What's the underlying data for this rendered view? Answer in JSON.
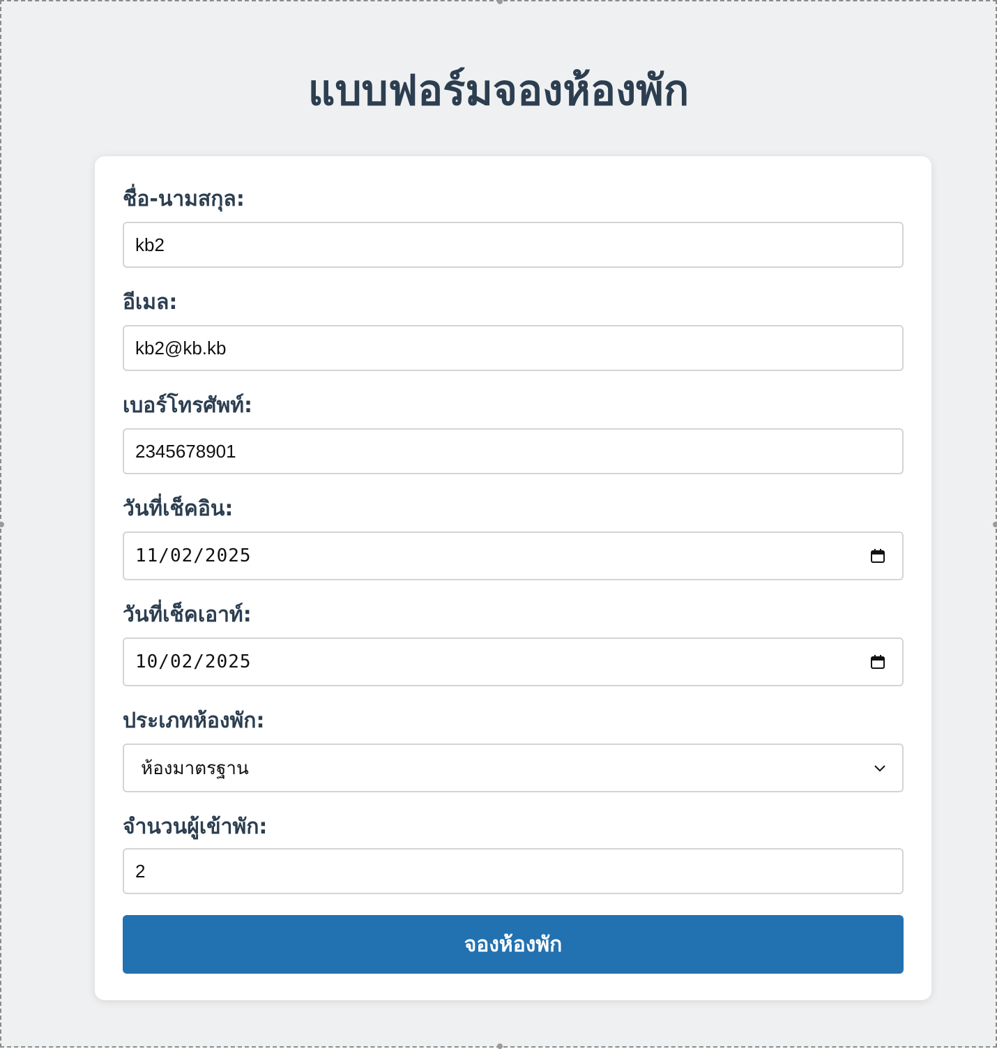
{
  "page": {
    "title": "แบบฟอร์มจองห้องพัก"
  },
  "form": {
    "name": {
      "label": "ชื่อ-นามสกุล:",
      "value": "kb2"
    },
    "email": {
      "label": "อีเมล:",
      "value": "kb2@kb.kb"
    },
    "phone": {
      "label": "เบอร์โทรศัพท์:",
      "value": "2345678901"
    },
    "checkin": {
      "label": "วันที่เช็คอิน:",
      "value": "11/02/2025",
      "icon": "calendar-icon"
    },
    "checkout": {
      "label": "วันที่เช็คเอาท์:",
      "value": "10/02/2025",
      "icon": "calendar-icon"
    },
    "room_type": {
      "label": "ประเภทห้องพัก:",
      "selected": "ห้องมาตรฐาน",
      "icon": "chevron-down-icon"
    },
    "guests": {
      "label": "จำนวนผู้เข้าพัก:",
      "value": "2"
    },
    "submit_label": "จองห้องพัก"
  },
  "colors": {
    "background": "#eff0f1",
    "card": "#ffffff",
    "heading": "#2c3e50",
    "button": "#2271b1",
    "button_text": "#ffffff",
    "input_border": "#d4d4d4"
  }
}
